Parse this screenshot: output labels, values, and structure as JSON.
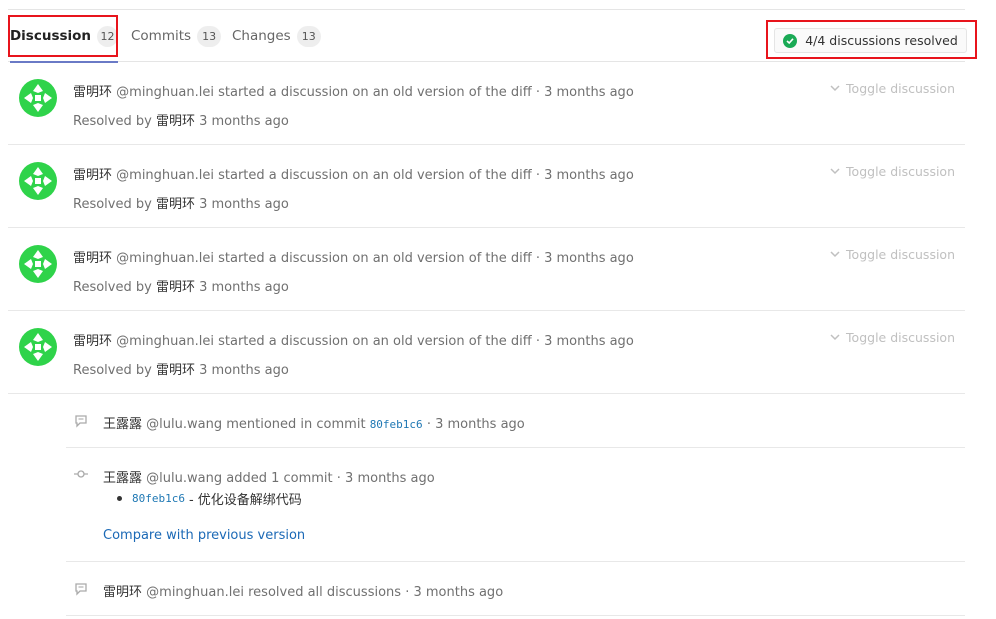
{
  "tabs": [
    {
      "label": "Discussion",
      "count": "12"
    },
    {
      "label": "Commits",
      "count": "13"
    },
    {
      "label": "Changes",
      "count": "13"
    }
  ],
  "resolved_status": "4/4 discussions resolved",
  "discussions": [
    {
      "author": "雷明环",
      "handle": "@minghuan.lei",
      "action": "started a discussion on an old version of the diff",
      "time": "· 3 months ago",
      "resolved_prefix": "Resolved by",
      "resolved_by": "雷明环",
      "resolved_time": "3 months ago",
      "toggle": "Toggle discussion"
    },
    {
      "author": "雷明环",
      "handle": "@minghuan.lei",
      "action": "started a discussion on an old version of the diff",
      "time": "· 3 months ago",
      "resolved_prefix": "Resolved by",
      "resolved_by": "雷明环",
      "resolved_time": "3 months ago",
      "toggle": "Toggle discussion"
    },
    {
      "author": "雷明环",
      "handle": "@minghuan.lei",
      "action": "started a discussion on an old version of the diff",
      "time": "· 3 months ago",
      "resolved_prefix": "Resolved by",
      "resolved_by": "雷明环",
      "resolved_time": "3 months ago",
      "toggle": "Toggle discussion"
    },
    {
      "author": "雷明环",
      "handle": "@minghuan.lei",
      "action": "started a discussion on an old version of the diff",
      "time": "· 3 months ago",
      "resolved_prefix": "Resolved by",
      "resolved_by": "雷明环",
      "resolved_time": "3 months ago",
      "toggle": "Toggle discussion"
    }
  ],
  "system_notes": {
    "mention": {
      "author": "王露露",
      "handle": "@lulu.wang",
      "action": "mentioned in commit",
      "sha": "80feb1c6",
      "time": "· 3 months ago"
    },
    "commit_added": {
      "author": "王露露",
      "handle": "@lulu.wang",
      "action": "added 1 commit",
      "time": "· 3 months ago",
      "sha": "80feb1c6",
      "message": "- 优化设备解绑代码",
      "compare_label": "Compare with previous version"
    },
    "resolved_all": {
      "author": "雷明环",
      "handle": "@minghuan.lei",
      "action": "resolved all discussions",
      "time": "· 3 months ago"
    }
  },
  "colors": {
    "accent": "#6a7ac6",
    "highlight": "#e8141c",
    "success": "#1aaa55",
    "link": "#1b69b6",
    "avatar": "#2fd34a"
  }
}
